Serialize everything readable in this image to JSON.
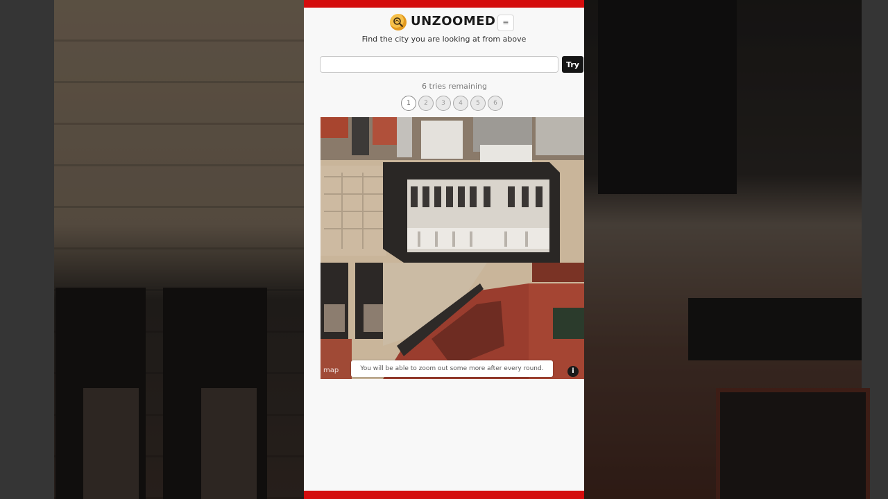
{
  "app": {
    "title": "UNZOOMED",
    "subtitle": "Find the city you are looking at from above",
    "menu_icon": "≡"
  },
  "guess": {
    "value": "",
    "placeholder": "",
    "submit_label": "Try"
  },
  "tries": {
    "text": "6 tries remaining",
    "attempts": [
      "1",
      "2",
      "3",
      "4",
      "5",
      "6"
    ],
    "current": 1
  },
  "map": {
    "hint": "You will be able to zoom out some more after every round.",
    "info_icon": "i",
    "attribution": "map"
  },
  "colors": {
    "accent_bar": "#d40d0d",
    "button": "#151515",
    "logo": "#f6c04a"
  }
}
